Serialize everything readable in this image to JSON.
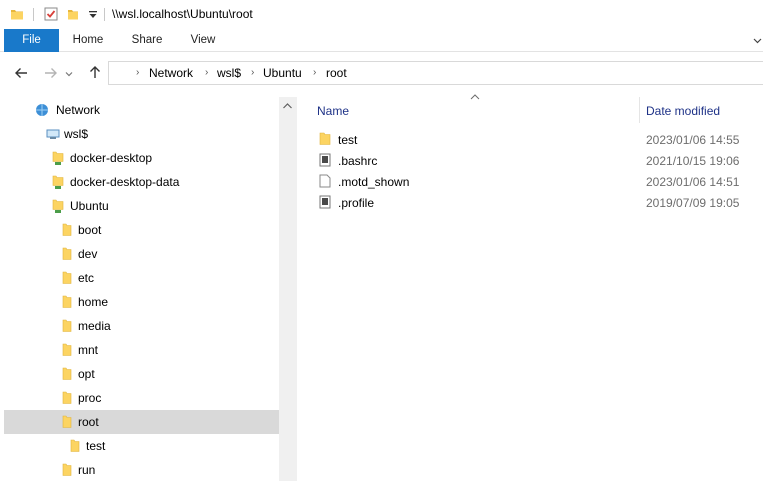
{
  "window": {
    "title": "\\\\wsl.localhost\\Ubuntu\\root"
  },
  "quick_access": {
    "icons": [
      "folder-icon",
      "properties-icon",
      "new-folder-icon",
      "customize-dropdown-icon"
    ]
  },
  "ribbon": {
    "tabs": [
      {
        "label": "File"
      },
      {
        "label": "Home"
      },
      {
        "label": "Share"
      },
      {
        "label": "View"
      }
    ],
    "active_tab": "File",
    "accent_color": "#1979ca"
  },
  "navigation": {
    "breadcrumbs": [
      "Network",
      "wsl$",
      "Ubuntu",
      "root"
    ]
  },
  "navpane": {
    "items": [
      {
        "label": "Network",
        "icon": "network-icon"
      },
      {
        "label": "wsl$",
        "icon": "network-share-icon"
      },
      {
        "label": "docker-desktop",
        "icon": "network-folder-icon"
      },
      {
        "label": "docker-desktop-data",
        "icon": "network-folder-icon"
      },
      {
        "label": "Ubuntu",
        "icon": "network-folder-icon"
      },
      {
        "label": "boot",
        "icon": "folder-icon"
      },
      {
        "label": "dev",
        "icon": "folder-icon"
      },
      {
        "label": "etc",
        "icon": "folder-icon"
      },
      {
        "label": "home",
        "icon": "folder-icon"
      },
      {
        "label": "media",
        "icon": "folder-icon"
      },
      {
        "label": "mnt",
        "icon": "folder-icon"
      },
      {
        "label": "opt",
        "icon": "folder-icon"
      },
      {
        "label": "proc",
        "icon": "folder-icon"
      },
      {
        "label": "root",
        "icon": "folder-icon",
        "selected": true
      },
      {
        "label": "test",
        "icon": "folder-icon"
      },
      {
        "label": "run",
        "icon": "folder-icon"
      }
    ],
    "selected_color": "#d9d9d9"
  },
  "filelist": {
    "columns": [
      "Name",
      "Date modified"
    ],
    "rows": [
      {
        "name": "test",
        "date": "2023/01/06 14:55",
        "icon": "folder-icon"
      },
      {
        "name": ".bashrc",
        "date": "2021/10/15 19:06",
        "icon": "system-file-icon"
      },
      {
        "name": ".motd_shown",
        "date": "2023/01/06 14:51",
        "icon": "blank-file-icon"
      },
      {
        "name": ".profile",
        "date": "2019/07/09 19:05",
        "icon": "system-file-icon"
      }
    ]
  }
}
